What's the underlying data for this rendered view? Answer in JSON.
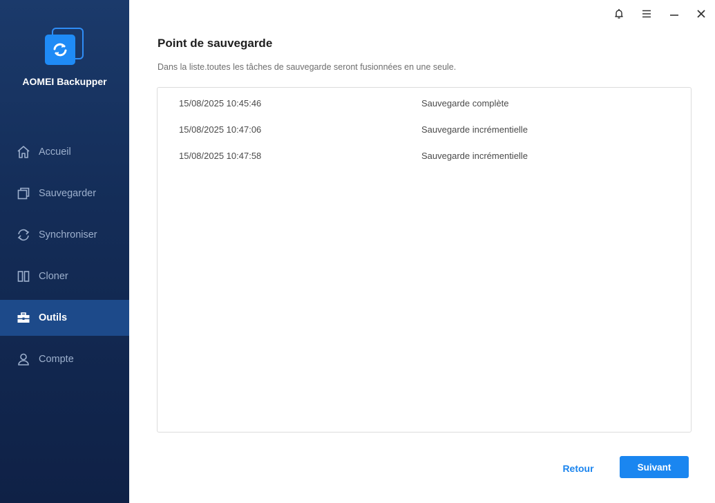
{
  "app": {
    "name": "AOMEI Backupper"
  },
  "sidebar": {
    "items": [
      {
        "label": "Accueil",
        "icon": "home-icon",
        "active": false
      },
      {
        "label": "Sauvegarder",
        "icon": "backup-icon",
        "active": false
      },
      {
        "label": "Synchroniser",
        "icon": "sync-icon",
        "active": false
      },
      {
        "label": "Cloner",
        "icon": "clone-icon",
        "active": false
      },
      {
        "label": "Outils",
        "icon": "toolbox-icon",
        "active": true
      },
      {
        "label": "Compte",
        "icon": "user-icon",
        "active": false
      }
    ]
  },
  "window_controls": [
    "bell-icon",
    "menu-icon",
    "minimize-icon",
    "close-icon"
  ],
  "main": {
    "title": "Point de sauvegarde",
    "subtitle": "Dans la liste.toutes les tâches de sauvegarde seront fusionnées en une seule.",
    "rows": [
      {
        "date": "15/08/2025 10:45:46",
        "type": "Sauvegarde complète"
      },
      {
        "date": "15/08/2025 10:47:06",
        "type": "Sauvegarde incrémentielle"
      },
      {
        "date": "15/08/2025 10:47:58",
        "type": "Sauvegarde incrémentielle"
      }
    ]
  },
  "footer": {
    "back_label": "Retour",
    "next_label": "Suivant"
  },
  "colors": {
    "sidebar_bg": "#142d58",
    "active_item": "#1d4a8a",
    "accent": "#1a86f0"
  }
}
